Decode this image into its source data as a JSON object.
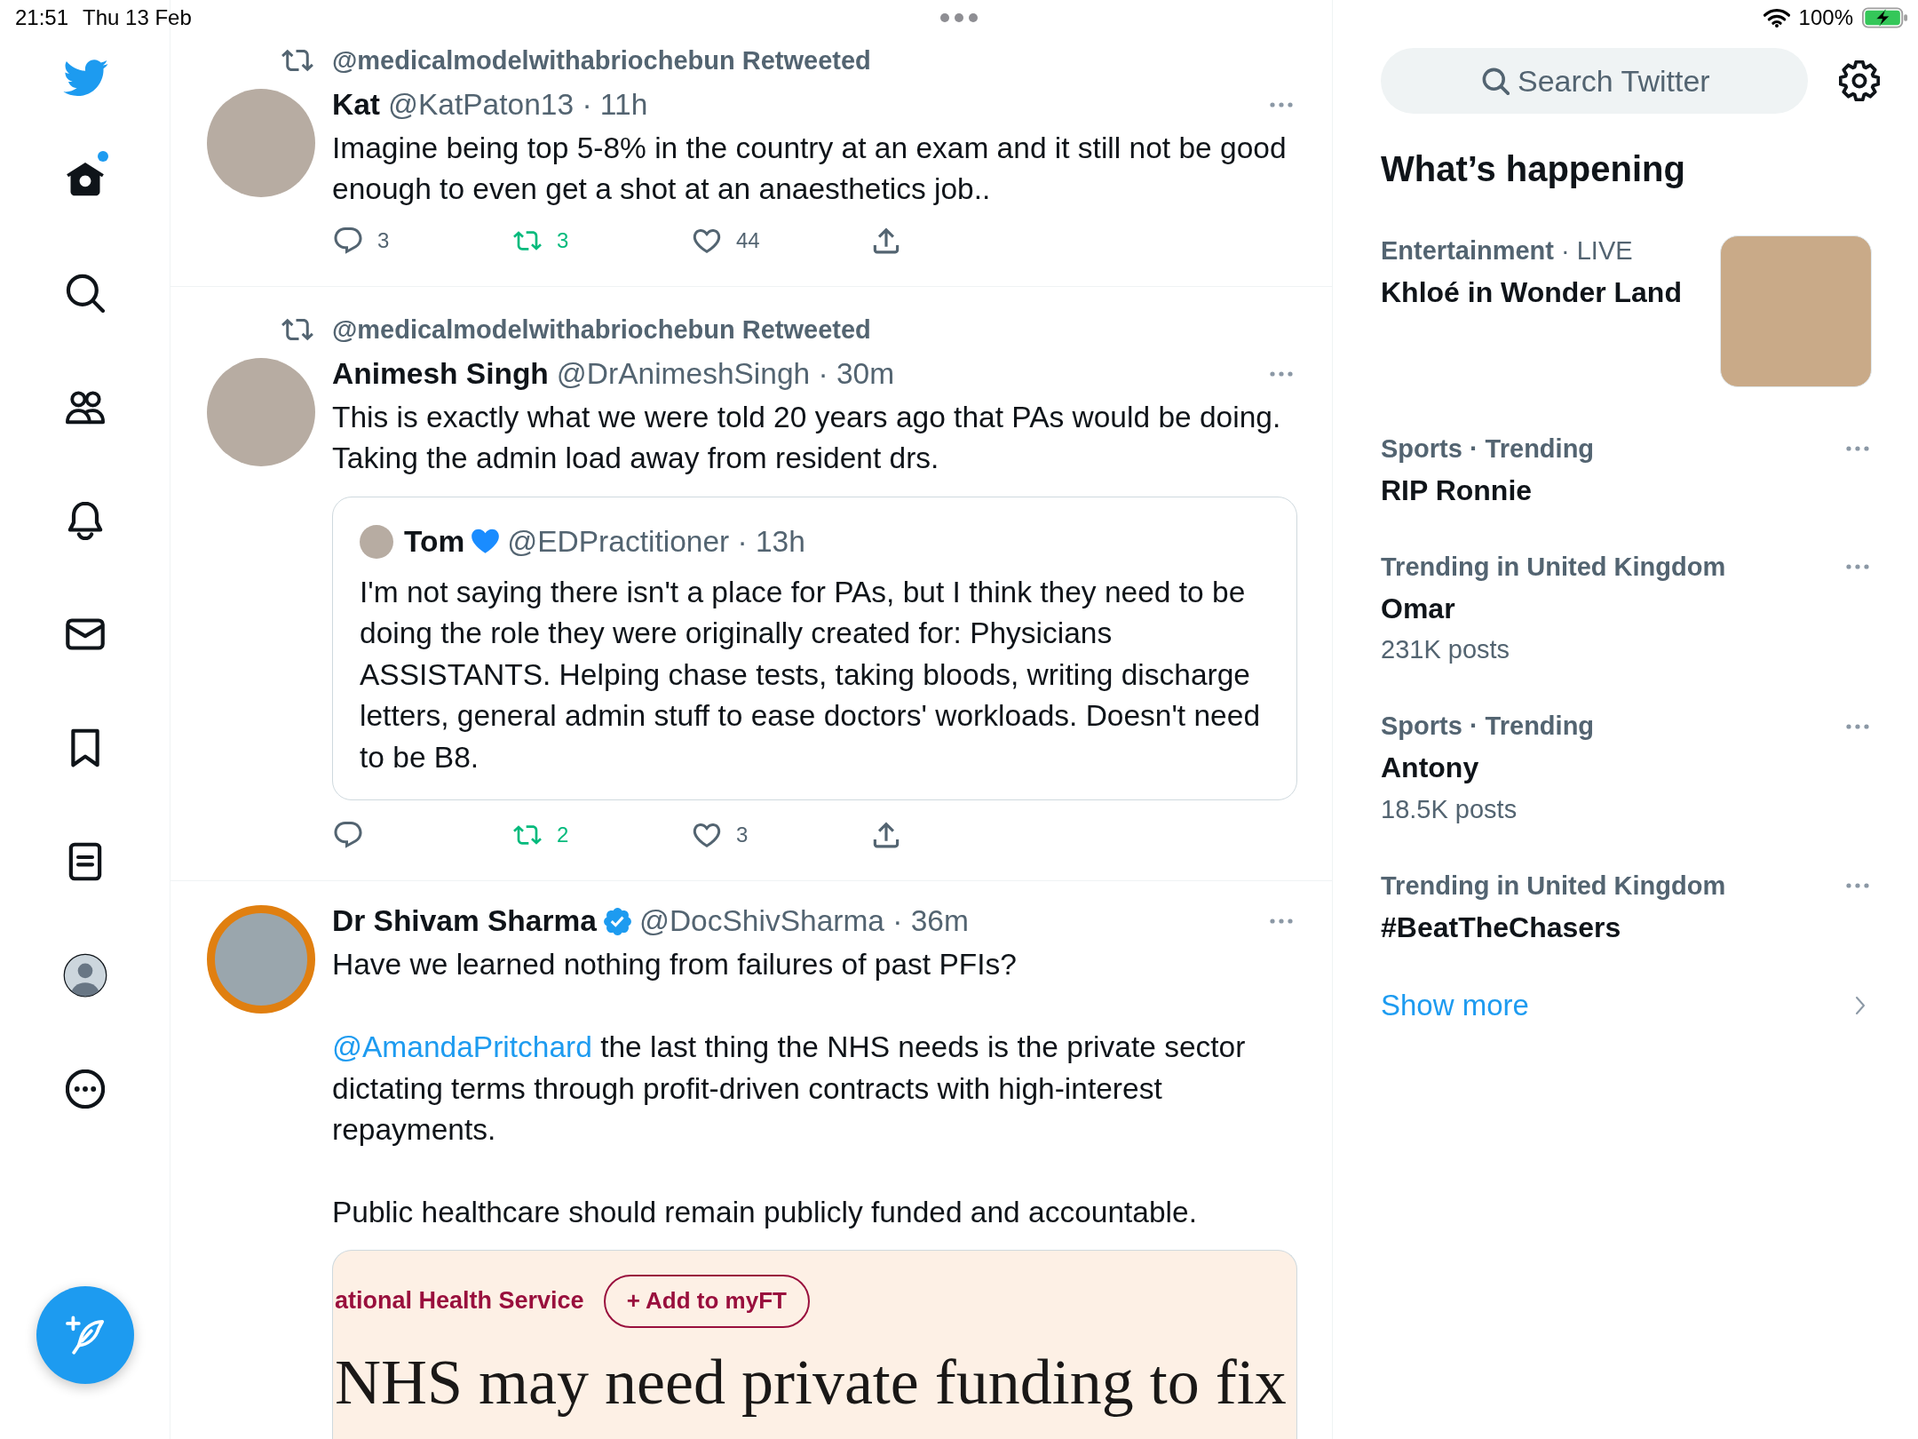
{
  "status_bar": {
    "time": "21:51",
    "date": "Thu 13 Feb",
    "battery": "100%"
  },
  "sidebar": {
    "items": [
      {
        "kind": "home",
        "selected": true,
        "unread": true
      },
      {
        "kind": "search",
        "selected": false,
        "unread": false
      },
      {
        "kind": "communities",
        "selected": false,
        "unread": false
      },
      {
        "kind": "notifications",
        "selected": false,
        "unread": false
      },
      {
        "kind": "messages",
        "selected": false,
        "unread": false
      },
      {
        "kind": "bookmarks",
        "selected": false,
        "unread": false
      },
      {
        "kind": "lists",
        "selected": false,
        "unread": false
      },
      {
        "kind": "profile",
        "selected": false,
        "unread": false
      },
      {
        "kind": "more",
        "selected": false,
        "unread": false
      }
    ]
  },
  "tweets": [
    {
      "retweeted_by": "@medicalmodelwithabriochebun Retweeted",
      "avatar_frame": false,
      "name": "Kat",
      "verified": false,
      "handle_time": "@KatPaton13 · 11h",
      "paragraphs": [
        {
          "text": "Imagine being top 5-8% in the country at an exam and it still not be good enough to even get a shot at an anaesthetics job.."
        }
      ],
      "actions": [
        {
          "kind": "reply",
          "count": "3",
          "active": false
        },
        {
          "kind": "retweet",
          "count": "3",
          "active": true
        },
        {
          "kind": "like",
          "count": "44",
          "active": false
        },
        {
          "kind": "share",
          "active": false
        }
      ]
    },
    {
      "retweeted_by": "@medicalmodelwithabriochebun Retweeted",
      "avatar_frame": false,
      "name": "Animesh Singh",
      "verified": false,
      "handle_time": "@DrAnimeshSingh · 30m",
      "paragraphs": [
        {
          "text": "This is exactly what we were told 20 years ago that PAs would be doing. Taking the admin load away from resident drs."
        }
      ],
      "quote": {
        "name": "Tom",
        "heart_emoji": true,
        "handle_time": "@EDPractitioner · 13h",
        "text": "I'm not saying there isn't a place for PAs, but I think they need to be doing the role they were originally created for: Physicians ASSISTANTS. Helping chase tests, taking bloods, writing discharge letters, general admin stuff to ease doctors' workloads. Doesn't need to be B8."
      },
      "actions": [
        {
          "kind": "reply",
          "active": false
        },
        {
          "kind": "retweet",
          "count": "2",
          "active": true
        },
        {
          "kind": "like",
          "count": "3",
          "active": false
        },
        {
          "kind": "share",
          "active": false
        }
      ]
    },
    {
      "avatar_frame": true,
      "name": "Dr Shivam Sharma",
      "verified": true,
      "handle_time": "@DocShivSharma · 36m",
      "paragraphs": [
        {
          "text": "Have we learned nothing from failures of past PFIs?"
        },
        {
          "mention": "@AmandaPritchard",
          "text": "the last thing the NHS needs is the private sector dictating terms through profit-driven contracts with high-interest repayments."
        },
        {
          "text": "Public healthcare should remain publicly funded and accountable."
        }
      ],
      "card": {
        "section": "ational Health Service",
        "button": "+ Add to myFT",
        "headline": "NHS may need private funding to fix"
      }
    }
  ],
  "right_panel": {
    "search": {
      "placeholder": "Search Twitter"
    },
    "title": "What’s happening",
    "trends": [
      {
        "kind": "event",
        "context": "Entertainment",
        "context_extra": "· LIVE",
        "name": "Khloé in Wonder Land"
      },
      {
        "kind": "trend",
        "context": "Sports · Trending",
        "name": "RIP Ronnie"
      },
      {
        "kind": "trend",
        "context": "Trending in United Kingdom",
        "name": "Omar",
        "posts": "231K posts"
      },
      {
        "kind": "trend",
        "context": "Sports · Trending",
        "name": "Antony",
        "posts": "18.5K posts"
      },
      {
        "kind": "trend",
        "context": "Trending in United Kingdom",
        "name": "#BeatTheChasers"
      }
    ],
    "show_more": "Show more"
  }
}
